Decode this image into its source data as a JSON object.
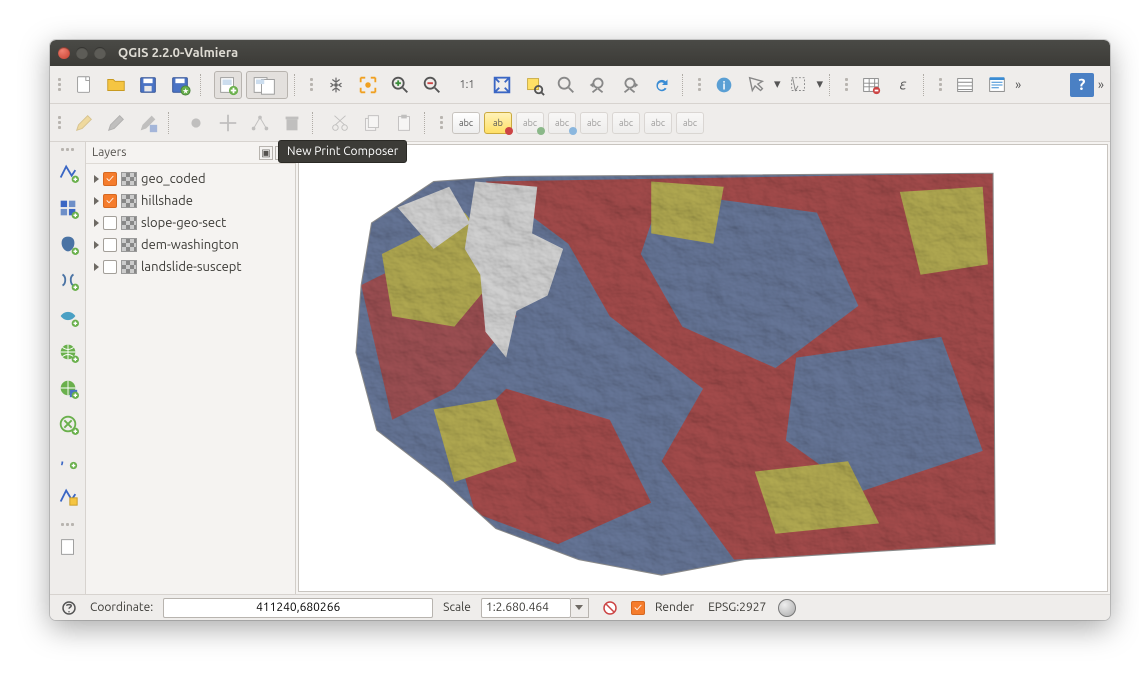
{
  "window": {
    "title": "QGIS 2.2.0-Valmiera"
  },
  "tooltip": "New Print Composer",
  "layers_panel": {
    "title": "Layers",
    "items": [
      {
        "name": "geo_coded",
        "checked": true
      },
      {
        "name": "hillshade",
        "checked": true
      },
      {
        "name": "slope-geo-sect",
        "checked": false
      },
      {
        "name": "dem-washington",
        "checked": false
      },
      {
        "name": "landslide-suscept",
        "checked": false
      }
    ]
  },
  "statusbar": {
    "coord_label": "Coordinate:",
    "coordinate": "411240,680266",
    "scale_label": "Scale",
    "scale_value": "1:2.680.464",
    "render_label": "Render",
    "crs": "EPSG:2927"
  },
  "toolbar_labels": {
    "abc": "abc",
    "ab": "ab"
  },
  "map": {
    "colors": {
      "blue": "#7c8fb8",
      "red": "#c75b5b",
      "yellow": "#d8ce62",
      "water": "#ffffff"
    }
  }
}
